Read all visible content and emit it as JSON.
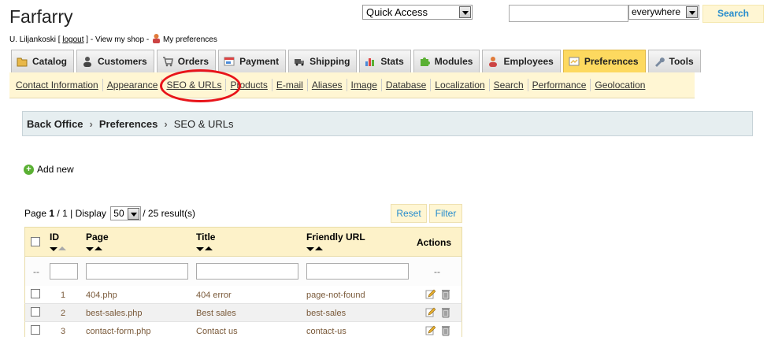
{
  "header": {
    "shop_name": "Farfarry",
    "user": "U. Liljankoski",
    "logout_label": "logout",
    "view_shop": "View my shop",
    "my_preferences": "My preferences",
    "quick_access": "Quick Access",
    "search_scope": "everywhere",
    "search_button": "Search"
  },
  "tabs": [
    {
      "label": "Catalog",
      "icon": "folder-icon"
    },
    {
      "label": "Customers",
      "icon": "customers-icon"
    },
    {
      "label": "Orders",
      "icon": "cart-icon"
    },
    {
      "label": "Payment",
      "icon": "payment-icon"
    },
    {
      "label": "Shipping",
      "icon": "truck-icon"
    },
    {
      "label": "Stats",
      "icon": "stats-icon"
    },
    {
      "label": "Modules",
      "icon": "puzzle-icon"
    },
    {
      "label": "Employees",
      "icon": "employee-icon"
    },
    {
      "label": "Preferences",
      "icon": "preferences-icon",
      "active": true
    },
    {
      "label": "Tools",
      "icon": "wrench-icon"
    }
  ],
  "subnav": [
    "Contact Information",
    "Appearance",
    "SEO & URLs",
    "Products",
    "E-mail",
    "Aliases",
    "Image",
    "Database",
    "Localization",
    "Search",
    "Performance",
    "Geolocation"
  ],
  "breadcrumb": {
    "root": "Back Office",
    "parent": "Preferences",
    "current": "SEO & URLs"
  },
  "add_new": "Add new",
  "pager": {
    "page_label": "Page",
    "page": "1",
    "pages": "1",
    "display_label": "Display",
    "display": "50",
    "results": "/ 25 result(s)"
  },
  "buttons": {
    "reset": "Reset",
    "filter": "Filter"
  },
  "table": {
    "headers": {
      "id": "ID",
      "page": "Page",
      "title": "Title",
      "url": "Friendly URL",
      "actions": "Actions"
    },
    "filter_dash": "--",
    "rows": [
      {
        "id": "1",
        "page": "404.php",
        "title": "404 error",
        "url": "page-not-found"
      },
      {
        "id": "2",
        "page": "best-sales.php",
        "title": "Best sales",
        "url": "best-sales"
      },
      {
        "id": "3",
        "page": "contact-form.php",
        "title": "Contact us",
        "url": "contact-us"
      }
    ]
  },
  "colors": {
    "accent": "#268ccd",
    "tab_active": "#fdd95f",
    "subnav_bg": "#fff6d3",
    "highlight_ring": "#e8141a"
  }
}
